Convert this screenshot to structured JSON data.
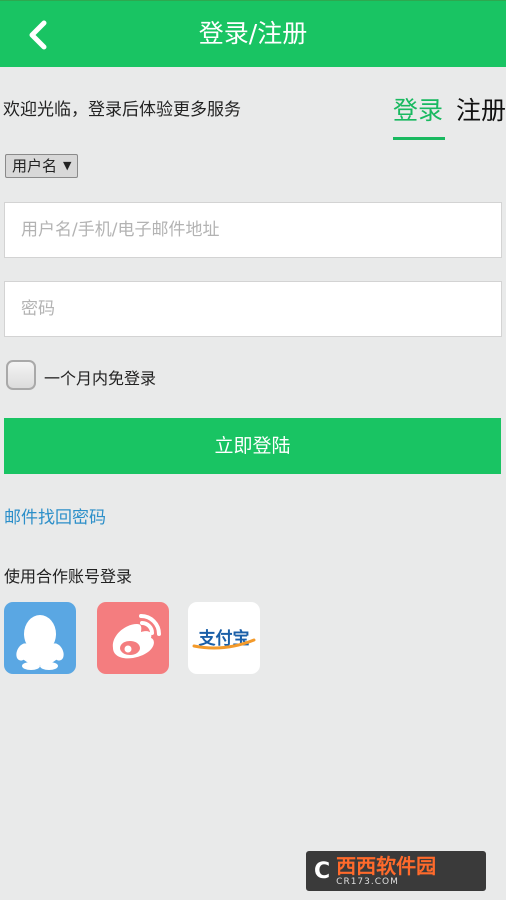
{
  "header": {
    "title": "登录/注册"
  },
  "welcome_text": "欢迎光临，登录后体验更多服务",
  "tabs": {
    "login": "登录",
    "register": "注册"
  },
  "account_type": {
    "selected": "用户名"
  },
  "fields": {
    "username_placeholder": "用户名/手机/电子邮件地址",
    "password_placeholder": "密码"
  },
  "remember": {
    "label": "一个月内免登录",
    "checked": false
  },
  "login_button": "立即登陆",
  "recover_link": "邮件找回密码",
  "partner": {
    "title": "使用合作账号登录",
    "providers": [
      {
        "name": "qq",
        "icon": "qq-penguin-icon"
      },
      {
        "name": "weibo",
        "icon": "weibo-icon"
      },
      {
        "name": "alipay",
        "label": "支付宝",
        "icon": "alipay-icon"
      }
    ]
  },
  "watermark": {
    "main": "西西软件园",
    "sub": "CR173.COM"
  },
  "colors": {
    "accent": "#19c463",
    "link": "#2c8fc9",
    "tab_active": "#19b960"
  }
}
